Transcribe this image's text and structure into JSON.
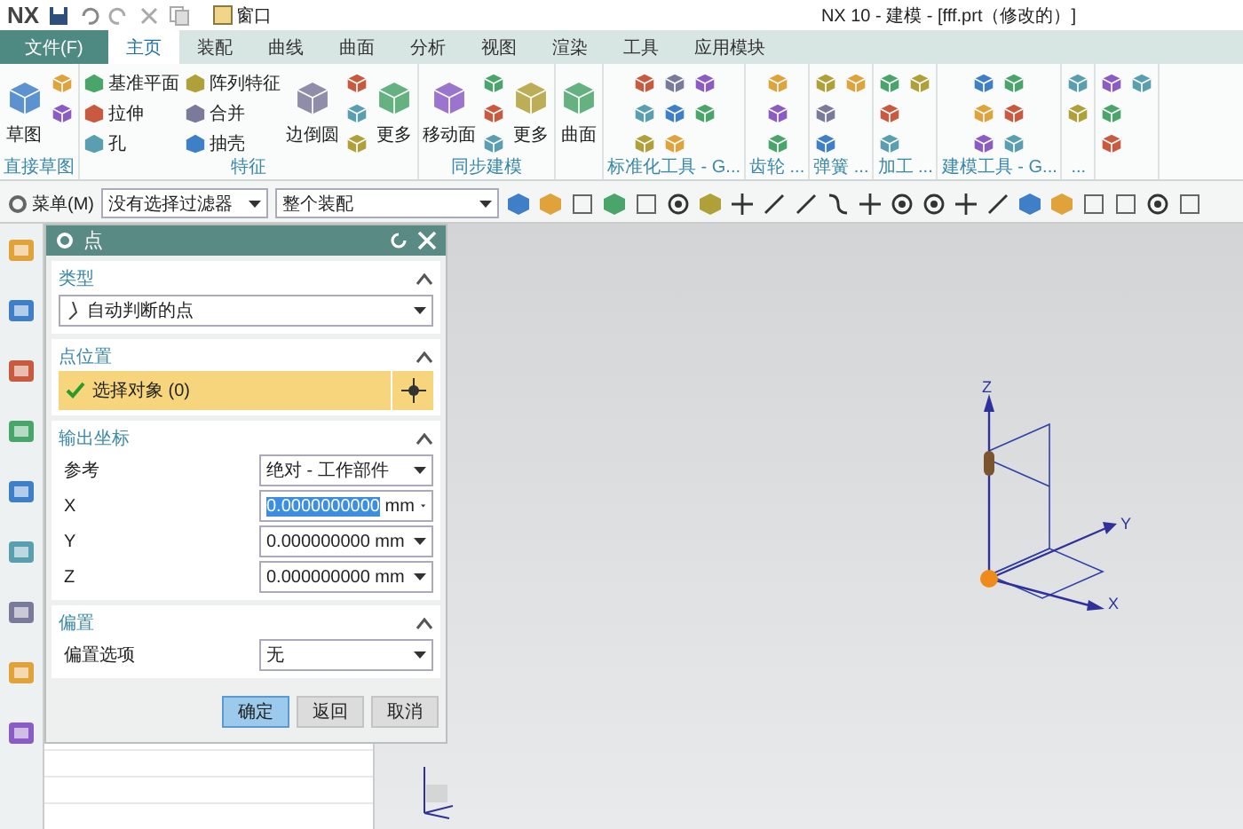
{
  "title_bar": {
    "logo": "NX",
    "window_menu": "窗口",
    "title": "NX 10 - 建模 - [fff.prt（修改的）]"
  },
  "tabs": [
    {
      "label": "文件(F)",
      "kind": "file",
      "selected": false
    },
    {
      "label": "主页",
      "kind": "tab",
      "selected": true
    },
    {
      "label": "装配",
      "kind": "tab",
      "selected": false
    },
    {
      "label": "曲线",
      "kind": "tab",
      "selected": false
    },
    {
      "label": "曲面",
      "kind": "tab",
      "selected": false
    },
    {
      "label": "分析",
      "kind": "tab",
      "selected": false
    },
    {
      "label": "视图",
      "kind": "tab",
      "selected": false
    },
    {
      "label": "渲染",
      "kind": "tab",
      "selected": false
    },
    {
      "label": "工具",
      "kind": "tab",
      "selected": false
    },
    {
      "label": "应用模块",
      "kind": "tab",
      "selected": false
    }
  ],
  "ribbon_groups": [
    {
      "label": "直接草图",
      "items": [
        {
          "kind": "large",
          "label": "草图"
        },
        {
          "kind": "icon"
        },
        {
          "kind": "icon"
        }
      ]
    },
    {
      "label": "特征",
      "items": [
        {
          "kind": "small",
          "label": "基准平面"
        },
        {
          "kind": "small",
          "label": "拉伸"
        },
        {
          "kind": "small",
          "label": "孔"
        },
        {
          "kind": "small",
          "label": "阵列特征"
        },
        {
          "kind": "small",
          "label": "合并"
        },
        {
          "kind": "small",
          "label": "抽壳"
        },
        {
          "kind": "large",
          "label": "边倒圆"
        },
        {
          "kind": "icon"
        },
        {
          "kind": "icon"
        },
        {
          "kind": "icon"
        },
        {
          "kind": "large",
          "label": "更多"
        }
      ]
    },
    {
      "label": "同步建模",
      "items": [
        {
          "kind": "large",
          "label": "移动面"
        },
        {
          "kind": "icon"
        },
        {
          "kind": "icon"
        },
        {
          "kind": "icon"
        },
        {
          "kind": "large",
          "label": "更多"
        }
      ]
    },
    {
      "items": [
        {
          "kind": "large",
          "label": "曲面"
        }
      ]
    },
    {
      "label": "标准化工具 - G...",
      "items": [
        {
          "kind": "icon"
        },
        {
          "kind": "icon"
        },
        {
          "kind": "icon"
        },
        {
          "kind": "icon"
        },
        {
          "kind": "icon"
        },
        {
          "kind": "icon"
        },
        {
          "kind": "icon"
        },
        {
          "kind": "icon"
        }
      ]
    },
    {
      "label": "齿轮 ...",
      "items": [
        {
          "kind": "icon"
        },
        {
          "kind": "icon"
        },
        {
          "kind": "icon"
        }
      ]
    },
    {
      "label": "弹簧 ...",
      "items": [
        {
          "kind": "icon"
        },
        {
          "kind": "icon"
        },
        {
          "kind": "icon"
        },
        {
          "kind": "icon"
        }
      ]
    },
    {
      "label": "加工 ...",
      "items": [
        {
          "kind": "icon"
        },
        {
          "kind": "icon"
        },
        {
          "kind": "icon"
        },
        {
          "kind": "icon"
        }
      ]
    },
    {
      "label": "建模工具 - G...",
      "items": [
        {
          "kind": "icon"
        },
        {
          "kind": "icon"
        },
        {
          "kind": "icon"
        },
        {
          "kind": "icon"
        },
        {
          "kind": "icon"
        },
        {
          "kind": "icon"
        }
      ]
    },
    {
      "label": "...",
      "items": [
        {
          "kind": "icon"
        },
        {
          "kind": "icon"
        }
      ]
    },
    {
      "items": [
        {
          "kind": "icon"
        },
        {
          "kind": "icon"
        },
        {
          "kind": "icon"
        },
        {
          "kind": "icon"
        }
      ]
    }
  ],
  "selection_bar": {
    "menu": "菜单(M)",
    "filter": "没有选择过滤器",
    "scope": "整个装配"
  },
  "dialog": {
    "title": "点",
    "sections": [
      {
        "title": "类型",
        "expanded": true,
        "rows": [
          {
            "kind": "dropdown",
            "value": "自动判断的点"
          }
        ]
      },
      {
        "title": "点位置",
        "expanded": true,
        "rows": [
          {
            "kind": "selection",
            "label": "选择对象 (0)"
          }
        ]
      },
      {
        "title": "输出坐标",
        "expanded": true,
        "rows": [
          {
            "kind": "labeled_dropdown",
            "label": "参考",
            "value": "绝对 - 工作部件"
          },
          {
            "kind": "coordinate",
            "label": "X",
            "value": "0.0000000000",
            "unit": "mm",
            "selected": true
          },
          {
            "kind": "coordinate",
            "label": "Y",
            "value": "0.000000000",
            "unit": "mm",
            "selected": false
          },
          {
            "kind": "coordinate",
            "label": "Z",
            "value": "0.000000000",
            "unit": "mm",
            "selected": false
          }
        ]
      },
      {
        "title": "偏置",
        "expanded": true,
        "rows": [
          {
            "kind": "labeled_dropdown",
            "label": "偏置选项",
            "value": "无"
          }
        ]
      }
    ],
    "buttons": [
      {
        "label": "确定",
        "selected": true
      },
      {
        "label": "返回",
        "selected": false
      },
      {
        "label": "取消",
        "selected": false
      }
    ]
  },
  "graphics": {
    "axis_labels": {
      "x": "X",
      "y": "Y",
      "z": "Z"
    }
  }
}
